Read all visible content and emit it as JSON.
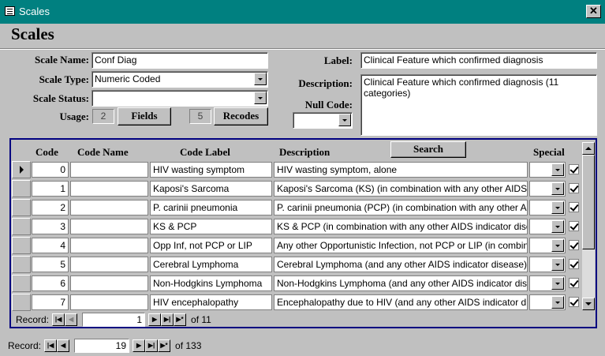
{
  "window": {
    "title": "Scales",
    "close_icon": "close-icon",
    "app_icon": "form-icon"
  },
  "form": {
    "title": "Scales",
    "scale_name_label": "Scale Name:",
    "scale_name_value": "Conf Diag",
    "scale_type_label": "Scale Type:",
    "scale_type_value": "Numeric Coded",
    "scale_status_label": "Scale Status:",
    "scale_status_value": "",
    "usage_label": "Usage:",
    "fields_count": "2",
    "fields_button": "Fields",
    "recodes_count": "5",
    "recodes_button": "Recodes",
    "label_label": "Label:",
    "label_value": "Clinical Feature which confirmed diagnosis",
    "description_label": "Description:",
    "description_value": "Clinical Feature which confirmed diagnosis (11 categories)",
    "null_code_label": "Null Code:",
    "null_code_value": ""
  },
  "subform": {
    "columns": {
      "code": "Code",
      "code_name": "Code Name",
      "code_label": "Code Label",
      "description": "Description",
      "special": "Special"
    },
    "search_button": "Search",
    "rows": [
      {
        "code": "0",
        "code_name": "",
        "code_label": "HIV wasting symptom",
        "description": "HIV wasting symptom, alone",
        "special": "",
        "checked": true
      },
      {
        "code": "1",
        "code_name": "",
        "code_label": "Kaposi's Sarcoma",
        "description": "Kaposi's Sarcoma (KS) (in combination with any other AIDS indicator disease)",
        "special": "",
        "checked": true
      },
      {
        "code": "2",
        "code_name": "",
        "code_label": "P. carinii pneumonia",
        "description": "P. carinii pneumonia (PCP) (in combination with any other AIDS indicator disease)",
        "special": "",
        "checked": true
      },
      {
        "code": "3",
        "code_name": "",
        "code_label": "KS & PCP",
        "description": "KS & PCP (in combination with any other AIDS indicator disease)",
        "special": "",
        "checked": true
      },
      {
        "code": "4",
        "code_name": "",
        "code_label": "Opp Inf, not PCP or LIP",
        "description": "Any other Opportunistic Infection, not PCP or LIP (in combination)",
        "special": "",
        "checked": true
      },
      {
        "code": "5",
        "code_name": "",
        "code_label": "Cerebral Lymphoma",
        "description": "Cerebral Lymphoma (and any other AIDS indicator disease)",
        "special": "",
        "checked": true
      },
      {
        "code": "6",
        "code_name": "",
        "code_label": "Non-Hodgkins Lymphoma",
        "description": "Non-Hodgkins Lymphoma (and any other AIDS indicator disease)",
        "special": "",
        "checked": true
      },
      {
        "code": "7",
        "code_name": "",
        "code_label": "HIV encephalopathy",
        "description": "Encephalopathy due to HIV (and any other AIDS indicator disease)",
        "special": "",
        "checked": true
      }
    ],
    "record_label": "Record:",
    "record_value": "1",
    "record_of": "of 11"
  },
  "main_nav": {
    "record_label": "Record:",
    "record_value": "19",
    "record_of": "of 133"
  },
  "colors": {
    "titlebar": "#008080",
    "subform_border": "#000080",
    "background": "#c0c0c0"
  }
}
